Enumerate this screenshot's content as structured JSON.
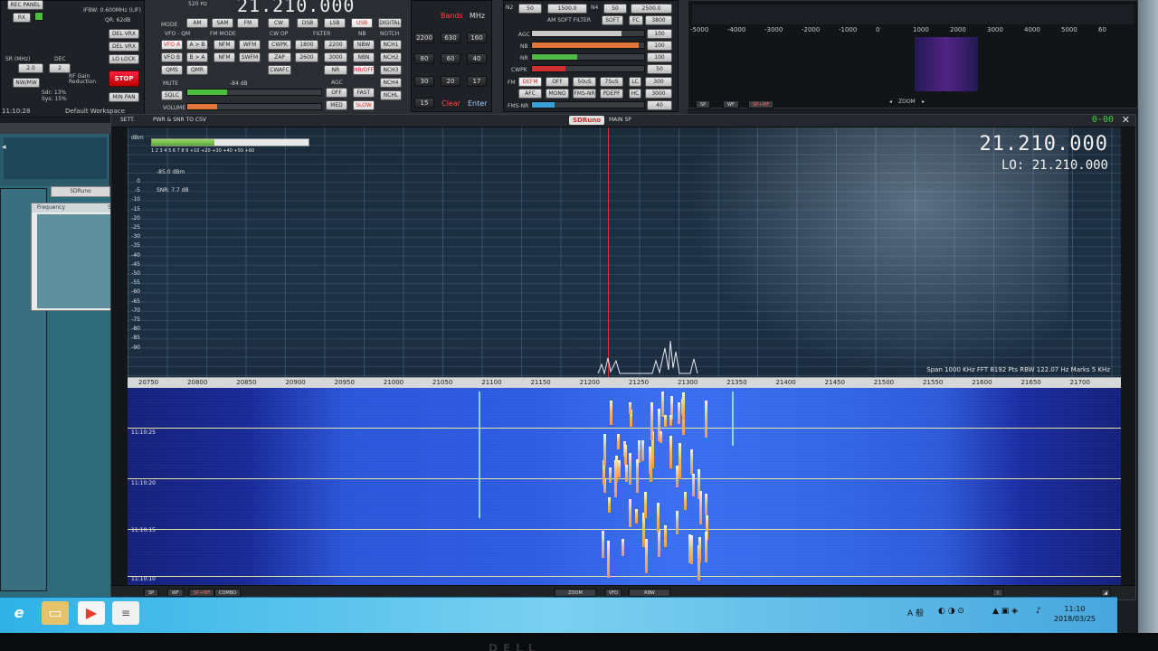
{
  "control_panel": {
    "frequency_top": "21.210.000",
    "bandwidth_label": "520 Hz",
    "ifbw": "IFBW: 0.600MHz (LIF)",
    "qr": "QR: 62dB",
    "sr_label": "SR (MHz)",
    "sr_value": "2.0",
    "dec_label": "DEC",
    "dec_value": "2",
    "rf_gain": "RF Gain Reduction",
    "time_left": "11:10:28",
    "workspace": "Default Workspace",
    "sdr_line": "Sdr: 13%",
    "sys_line": "Sys: 15%",
    "buttons_left": [
      "DEL VRX",
      "DEL VRX",
      "LO LOCK",
      "STOP",
      "MIN PAN"
    ],
    "mode_label": "MODE",
    "modes": [
      "AM",
      "SAM",
      "FM",
      "CW",
      "DSB",
      "LSB",
      "USB",
      "DIGITAL"
    ],
    "vfo_qm_label": "VFO - QM",
    "fm_mode_label": "FM MODE",
    "cw_op_label": "CW OP",
    "filter_label": "FILTER",
    "nb_label": "NB",
    "notch_label": "NOTCH",
    "vfo_buttons": [
      "VFO A",
      "VFO B",
      "QMS",
      "MUTE",
      "SQLC",
      "VOLUME"
    ],
    "ab_buttons": [
      "A > B",
      "B > A",
      "QMR"
    ],
    "fm_buttons": [
      "NFM",
      "WFM",
      "NFM",
      "SWFM"
    ],
    "cw_buttons": [
      "CWPK",
      "ZAP",
      "CWAFC"
    ],
    "filter_buttons": [
      "1800",
      "2200",
      "2600",
      "3000",
      "NR"
    ],
    "nb_buttons": [
      "NBW",
      "NBN",
      "NB/OFF"
    ],
    "notch_buttons": [
      "NCH1",
      "NCH2",
      "NCH3",
      "NCH4",
      "NCHL"
    ],
    "agc_label": "AGC",
    "agc_buttons": [
      "OFF",
      "FAST",
      "MED",
      "SLOW"
    ],
    "meter_value": "-84 dB",
    "keypad_label_bands": "Bands",
    "keypad_label_mhz": "MHz",
    "keypad": [
      "2200",
      "630",
      "160",
      "80",
      "60",
      "40",
      "30",
      "20",
      "17",
      "15",
      "Clear",
      "Enter"
    ],
    "n_fields": [
      {
        "label": "N2",
        "value": "50"
      },
      {
        "label": "",
        "value": "1500.0"
      },
      {
        "label": "N4",
        "value": "50"
      },
      {
        "label": "",
        "value": "2500.0"
      }
    ],
    "am_soft_filter": "AM SOFT FILTER",
    "soft_btn": "SOFT",
    "fc_label": "FC",
    "fc_value": "3800",
    "levels": [
      {
        "label": "AGC",
        "value": "100",
        "fill": 0.8,
        "color": "#c8c8c8"
      },
      {
        "label": "NB",
        "value": "100",
        "fill": 0.95,
        "color": "#e07838"
      },
      {
        "label": "NR",
        "value": "100",
        "fill": 0.4,
        "color": "#50b848"
      },
      {
        "label": "CWPK",
        "value": "50",
        "fill": 0.3,
        "color": "#d03030"
      }
    ],
    "fm_row": [
      "DEFM",
      "OFF",
      "50uS",
      "75uS"
    ],
    "lc_label": "LC",
    "lc_value": "300",
    "afc_row": [
      "AFC",
      "MONO",
      "FMS-NR",
      "PDEPF"
    ],
    "hc_label": "HC",
    "hc_value": "3000",
    "fms_nr_label": "FMS-NR",
    "fms_nr_value": "40"
  },
  "mini_spectrum": {
    "ticks": [
      "-5000",
      "-4000",
      "-3000",
      "-2000",
      "-1000",
      "0",
      "1000",
      "2000",
      "3000",
      "4000",
      "5000",
      "60"
    ],
    "tabs": [
      "SP",
      "WF",
      "SP+WF"
    ],
    "zoom_label": "ZOOM"
  },
  "main_window": {
    "settings_tab": "SETT.",
    "export_tab": "PWR & SNR TO CSV",
    "brand": "SDRuno",
    "title": "MAIN SP",
    "green_readout": "0-00",
    "close": "✕",
    "big_frequency": "21.210.000",
    "lo_frequency": "LO: 21.210.000",
    "dbm_label": "dBm",
    "s_scale": "1 2 3 4 5 6 7 8 9 +10 +20 +30 +40 +50 +60",
    "signal_fill": 0.4,
    "power_readout": "-85.0 dBm",
    "snr_readout": "SNR: 7.7 dB",
    "y_ticks": [
      "0",
      "-5",
      "-10",
      "-15",
      "-20",
      "-25",
      "-30",
      "-35",
      "-40",
      "-45",
      "-50",
      "-55",
      "-60",
      "-65",
      "-70",
      "-75",
      "-80",
      "-85",
      "-90"
    ],
    "status_line": "Span 1000 KHz  FFT 8192 Pts  RBW 122.07 Hz  Marks 5 KHz",
    "x_ticks": [
      "20750",
      "20800",
      "20850",
      "20900",
      "20950",
      "21000",
      "21050",
      "21100",
      "21150",
      "21200",
      "21250",
      "21300",
      "21350",
      "21400",
      "21450",
      "21500",
      "21550",
      "21600",
      "21650",
      "21700"
    ],
    "timestamps": [
      "11:10:25",
      "11:10:20",
      "11:10:15",
      "11:10:10"
    ],
    "bottom_tabs": [
      "SP",
      "WF",
      "SP+WF",
      "COMBO"
    ],
    "bottom_controls": [
      "ZOOM",
      "VFO",
      "RBW"
    ]
  },
  "left_panel": {
    "title": "SDRuno",
    "column_freq": "Frequency",
    "column_s": "S"
  },
  "taskbar": {
    "time": "11:10",
    "date": "2018/03/25",
    "ime": "A 般"
  },
  "colors": {
    "accent": "#d03030",
    "spectrum_bg": "#1e3246",
    "waterfall": "#2d5be0"
  }
}
